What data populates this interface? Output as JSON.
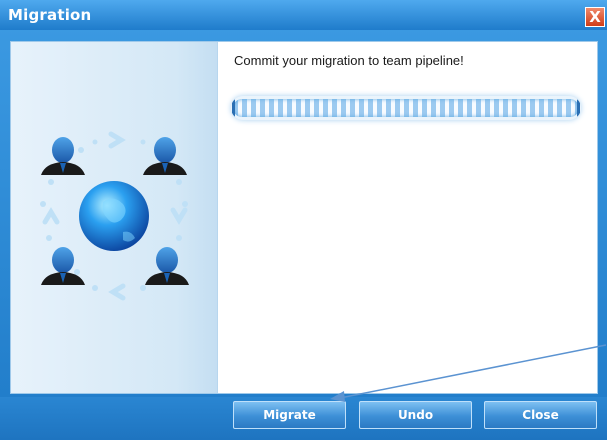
{
  "window": {
    "title": "Migration",
    "close_glyph": "X"
  },
  "main": {
    "message": "Commit your migration to team pipeline!",
    "progress": 1.0
  },
  "buttons": {
    "migrate": "Migrate",
    "undo": "Undo",
    "close": "Close"
  },
  "colors": {
    "title_bar": "#1f7ccb",
    "close_button": "#cf3d18",
    "accent": "#3d8fd6"
  },
  "icons": [
    "people-network-icon",
    "globe-icon",
    "person-icon",
    "annotation-arrow"
  ]
}
